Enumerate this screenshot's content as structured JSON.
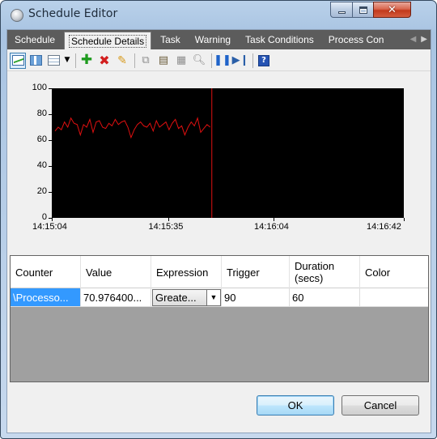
{
  "window": {
    "title": "Schedule Editor"
  },
  "tabs": [
    {
      "label": "Schedule"
    },
    {
      "label": "Schedule Details",
      "active": true
    },
    {
      "label": "Task"
    },
    {
      "label": "Warning"
    },
    {
      "label": "Task Conditions"
    },
    {
      "label": "Process Con­"
    }
  ],
  "toolbar": {
    "icons": [
      "graph-view-icon",
      "3d-view-icon",
      "histogram-view-icon",
      "dropdown-arrow-icon",
      "add-icon",
      "delete-icon",
      "edit-icon",
      "copy-icon",
      "paste-icon",
      "properties-icon",
      "zoom-icon",
      "pause-icon",
      "next-icon",
      "help-icon"
    ]
  },
  "chart_data": {
    "type": "line",
    "ylim": [
      0,
      100
    ],
    "yticks": [
      "0",
      "20",
      "40",
      "60",
      "80",
      "100"
    ],
    "xticks": [
      "14:15:04",
      "14:15:35",
      "14:16:04",
      "14:16:42"
    ],
    "series": [
      {
        "color": "#e01010",
        "values": [
          67,
          70,
          68,
          74,
          70,
          77,
          73,
          72,
          64,
          72,
          70,
          76,
          66,
          74,
          75,
          70,
          69,
          73,
          71,
          76,
          72,
          74,
          75,
          70,
          62,
          68,
          72,
          74,
          71,
          70,
          73,
          67,
          75,
          70,
          72,
          74,
          68,
          73,
          76,
          69,
          71,
          64,
          70,
          74,
          71,
          77,
          66,
          69,
          72,
          70
        ]
      }
    ],
    "current_time_fraction": 0.45
  },
  "grid": {
    "headers": [
      "Counter",
      "Value",
      "Expression",
      "Trigger",
      "Duration (secs)",
      "Color"
    ],
    "row": {
      "counter": "\\Processo...",
      "value": "70.976400...",
      "expression": "Greate...",
      "trigger": "90",
      "duration": "60",
      "color": ""
    }
  },
  "buttons": {
    "ok": "OK",
    "cancel": "Cancel"
  }
}
